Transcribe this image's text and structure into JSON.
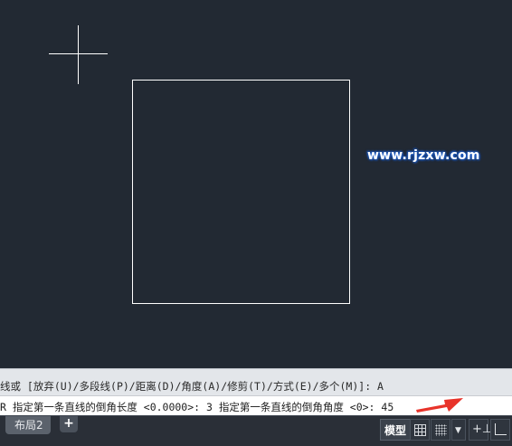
{
  "watermark": "www.rjzxw.com",
  "command": {
    "history_line": "线或 [放弃(U)/多段线(P)/距离(D)/角度(A)/修剪(T)/方式(E)/多个(M)]:  A",
    "current_line": "R 指定第一条直线的倒角长度 <0.0000>: 3 指定第一条直线的倒角角度 <0>: 45"
  },
  "statusbar": {
    "layout_tab": "布局2",
    "add_tab": "+",
    "model_button": "模型",
    "dropdown_glyph": "▼",
    "dynamic_input_glyph": "+⊥"
  },
  "colors": {
    "canvas": "#222933",
    "arrow": "#e8332a",
    "watermark_glow": "#1e5fc8"
  },
  "icons": [
    "crosshair-cursor",
    "grid-icon",
    "snap-icon",
    "chevron-down-icon",
    "dynamic-input-icon",
    "ortho-icon",
    "red-arrow"
  ]
}
